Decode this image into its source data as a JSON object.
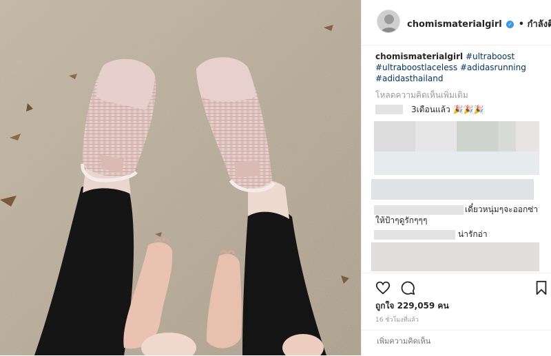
{
  "post": {
    "username": "chomismaterialgirl",
    "follow_label": "• กำลังติดตาม",
    "caption_user": "chomismaterialgirl",
    "hashtags": [
      "#ultraboost",
      "#ultraboostlaceless",
      "#adidasrunning",
      "#adidasthailand"
    ],
    "load_more": "โหลดความคิดเห็นเพิ่มเติม",
    "comments": [
      {
        "text": "3เดือนแล้ว"
      },
      {
        "text": "เดี๋ยวหนุ่มๆจะออกซ่า"
      },
      {
        "text": "ให้ป้าๆดูรักๆๆๆ"
      },
      {
        "text": "น่ารักอ่า"
      }
    ],
    "likes_label": "ถูกใจ 229,059 คน",
    "time_label": "16 ชั่วโมงที่แล้ว",
    "add_comment_placeholder": "เพิ่มความคิดเห็น"
  },
  "icons": [
    "verified-badge-icon",
    "heart-icon",
    "comment-icon",
    "bookmark-icon",
    "party-popper-icon"
  ],
  "colors": {
    "sand": "#b7ab96",
    "shoe": "#e3c9c4",
    "leggings": "#141414",
    "link": "#003569",
    "verified": "#3897f0"
  }
}
